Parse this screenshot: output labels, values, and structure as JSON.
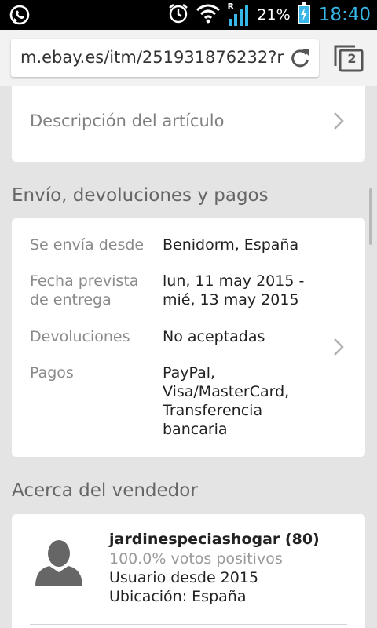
{
  "status_bar": {
    "left_icon": "whatsapp-icon",
    "icons": [
      "alarm-icon",
      "wifi-icon",
      "signal-icon",
      "battery-icon"
    ],
    "signal_letter": "R",
    "battery_percent": "21%",
    "time": "18:40"
  },
  "browser": {
    "url": "m.ebay.es/itm/251931876232?r",
    "tab_count": "2"
  },
  "item_description": {
    "label": "Descripción del artículo"
  },
  "shipping": {
    "title": "Envío, devoluciones y pagos",
    "rows": [
      {
        "label": "Se envía desde",
        "value": "Benidorm, España"
      },
      {
        "label_lines": [
          "Fecha prevista",
          "de entrega"
        ],
        "value_lines": [
          "lun, 11 may 2015 -",
          "mié, 13 may 2015"
        ]
      },
      {
        "label": "Devoluciones",
        "value": "No aceptadas"
      },
      {
        "label": "Pagos",
        "value_lines": [
          "PayPal,",
          "Visa/MasterCard,",
          "Transferencia",
          "bancaria"
        ]
      }
    ]
  },
  "seller": {
    "title": "Acerca del vendedor",
    "name": "jardinespeciashogar (80)",
    "rating": "100.0% votos positivos",
    "since": "Usuario desde 2015",
    "location": "Ubicación: España"
  },
  "colors": {
    "status_time": "#39b6e8",
    "background": "#e4e4e4",
    "card": "#ffffff"
  }
}
